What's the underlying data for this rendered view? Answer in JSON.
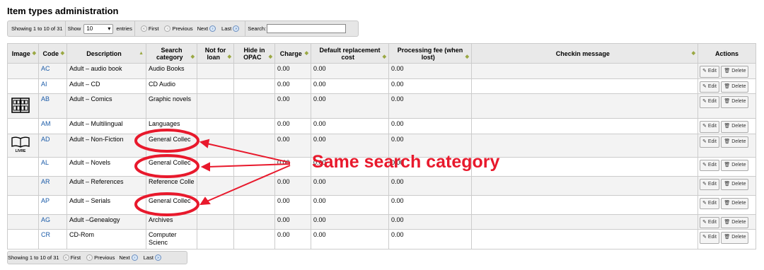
{
  "page": {
    "title": "Item types administration"
  },
  "pager": {
    "info": "Showing 1 to 10 of 31",
    "show_label": "Show",
    "show_value": "10",
    "entries_label": "entries",
    "first": "First",
    "previous": "Previous",
    "next": "Next",
    "last": "Last",
    "search_label": "Search:"
  },
  "table": {
    "headers": [
      "Image",
      "Code",
      "Description",
      "Search category",
      "Not for loan",
      "Hide in OPAC",
      "Charge",
      "Default replacement cost",
      "Processing fee (when lost)",
      "Checkin message",
      "Actions"
    ],
    "rows": [
      {
        "image": "",
        "code": "AC",
        "description": "Adult – audio book",
        "category": "Audio Books",
        "charge": "0.00",
        "replacement": "0.00",
        "fee": "0.00"
      },
      {
        "image": "",
        "code": "AI",
        "description": "Adult – CD",
        "category": "CD Audio",
        "charge": "0.00",
        "replacement": "0.00",
        "fee": "0.00"
      },
      {
        "image": "comics-icon",
        "code": "AB",
        "description": "Adult – Comics",
        "category": "Graphic novels",
        "charge": "0.00",
        "replacement": "0.00",
        "fee": "0.00"
      },
      {
        "image": "",
        "code": "AM",
        "description": "Adult – Multilingual",
        "category": "Languages",
        "charge": "0.00",
        "replacement": "0.00",
        "fee": "0.00"
      },
      {
        "image": "book-icon",
        "code": "AD",
        "description": "Adult – Non-Fiction",
        "category": "General Collec",
        "charge": "0.00",
        "replacement": "0.00",
        "fee": "0.00"
      },
      {
        "image": "",
        "code": "AL",
        "description": "Adult – Novels",
        "category": "General Collec",
        "charge": "0.00",
        "replacement": "0.00",
        "fee": "0.00"
      },
      {
        "image": "",
        "code": "AR",
        "description": "Adult – References",
        "category": "Reference Colle",
        "charge": "0.00",
        "replacement": "0.00",
        "fee": "0.00"
      },
      {
        "image": "",
        "code": "AP",
        "description": "Adult – Serials",
        "category": "General Collec",
        "charge": "0.00",
        "replacement": "0.00",
        "fee": "0.00"
      },
      {
        "image": "",
        "code": "AG",
        "description": "Adult –Genealogy",
        "category": "Archives",
        "charge": "0.00",
        "replacement": "0.00",
        "fee": "0.00"
      },
      {
        "image": "",
        "code": "CR",
        "description": "CD-Rom",
        "category": "Computer Scienc",
        "charge": "0.00",
        "replacement": "0.00",
        "fee": "0.00"
      }
    ],
    "edit_label": "Edit",
    "delete_label": "Delete"
  },
  "image_caption": "LIVRE",
  "annotation": {
    "text": "Same search category",
    "color": "#e8192c"
  }
}
